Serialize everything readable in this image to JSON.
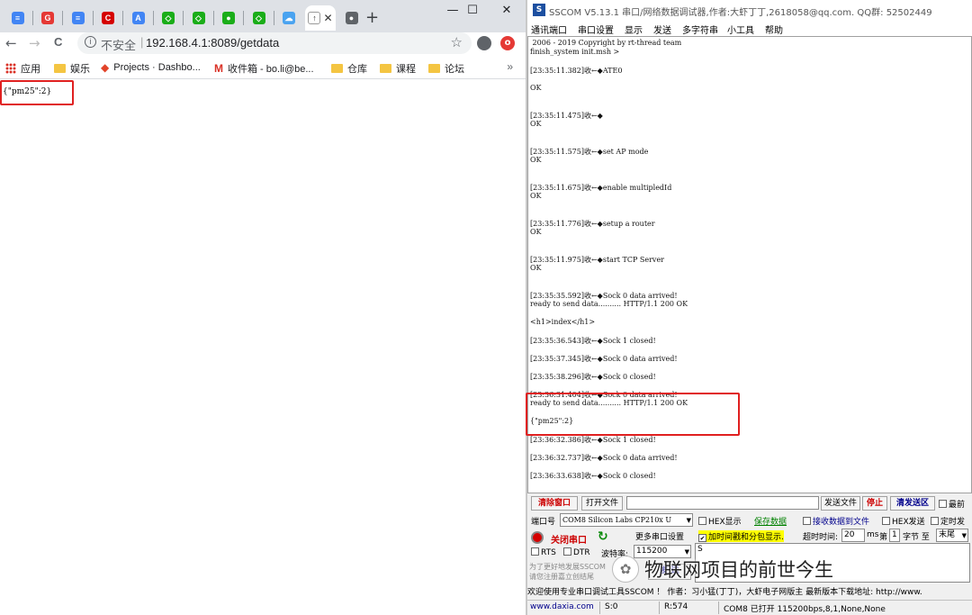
{
  "browser": {
    "tabs": [
      {
        "icon": "docs-icon",
        "color": "#4285f4",
        "glyph": "≡"
      },
      {
        "icon": "g-red-icon",
        "color": "#e53935",
        "glyph": "G"
      },
      {
        "icon": "docs-icon",
        "color": "#4285f4",
        "glyph": "≡"
      },
      {
        "icon": "c-red-icon",
        "color": "#d50000",
        "glyph": "C"
      },
      {
        "icon": "translate-icon",
        "color": "#4285f4",
        "glyph": "A"
      },
      {
        "icon": "recycle-green-icon",
        "color": "#1aad19",
        "glyph": "◇"
      },
      {
        "icon": "recycle-green-icon",
        "color": "#1aad19",
        "glyph": "◇"
      },
      {
        "icon": "wechat-icon",
        "color": "#1aad19",
        "glyph": "●"
      },
      {
        "icon": "recycle-green-icon",
        "color": "#1aad19",
        "glyph": "◇"
      },
      {
        "icon": "cloud-icon",
        "color": "#4aa3f0",
        "glyph": "☁"
      },
      {
        "icon": "page-icon",
        "color": "#ffffff",
        "glyph": "↑",
        "active": true
      },
      {
        "icon": "globe-icon",
        "color": "#5f6368",
        "glyph": "●"
      }
    ],
    "new_tab": "+",
    "window_controls": {
      "minimize": "—",
      "maximize": "☐",
      "close": "✕"
    },
    "nav": {
      "back": "←",
      "forward": "→",
      "reload": "C"
    },
    "omnibox": {
      "info": "i",
      "insecure": "不安全",
      "separator": "|",
      "url": "192.168.4.1:8089/getdata",
      "star": "☆"
    },
    "extension_badge": "o",
    "bookmarks": [
      {
        "label": "应用",
        "icon": "apps-grid-icon"
      },
      {
        "label": "娱乐",
        "icon": "folder-icon"
      },
      {
        "label": "Projects · Dashbo...",
        "icon": "gitlab-icon"
      },
      {
        "label": "收件箱 - bo.li@be...",
        "icon": "gmail-icon"
      },
      {
        "label": "仓库",
        "icon": "folder-icon"
      },
      {
        "label": "课程",
        "icon": "folder-icon"
      },
      {
        "label": "论坛",
        "icon": "folder-icon"
      }
    ],
    "bookmarks_more": "»",
    "page_text": "{\"pm25\":2}"
  },
  "sscom": {
    "title": "SSCOM V5.13.1 串口/网络数据调试器,作者:大虾丁丁,2618058@qq.com. QQ群: 52502449",
    "logo": "S",
    "menus": [
      "通讯端口",
      "串口设置",
      "显示",
      "发送",
      "多字符串",
      "小工具",
      "帮助"
    ],
    "terminal_lines": [
      " 2006 - 2019 Copyright by rt-thread team",
      "finish_system init.msh >",
      "[23:35:11.382]收←◆ATE0",
      "OK",
      "[23:35:11.475]收←◆",
      "OK",
      "[23:35:11.575]收←◆set AP mode",
      "OK",
      "[23:35:11.675]收←◆enable multipledId",
      "OK",
      "[23:35:11.776]收←◆setup a router",
      "OK",
      "[23:35:11.975]收←◆start TCP Server",
      "OK",
      "[23:35:35.592]收←◆Sock 0 data arrived!",
      "ready to send data.......... HTTP/1.1 200 OK",
      "<h1>index</h1>",
      "[23:35:36.543]收←◆Sock 1 closed!",
      "[23:35:37.345]收←◆Sock 0 data arrived!",
      "[23:35:38.296]收←◆Sock 0 closed!",
      "[23:36:31.404]收←◆Sock 0 data arrived!",
      "ready to send data.......... HTTP/1.1 200 OK",
      "{\"pm25\":2}",
      "[23:36:32.386]收←◆Sock 1 closed!",
      "[23:36:32.737]收←◆Sock 0 data arrived!",
      "[23:36:33.638]收←◆Sock 0 closed!"
    ],
    "panel": {
      "clear_window": "清除窗口",
      "open_file": "打开文件",
      "send_file": "发送文件",
      "stop": "停止",
      "clear_send": "清发送区",
      "last": "最前",
      "port_label": "端口号",
      "port_value": "COM8 Silicon Labs CP210x U",
      "hex_display": "HEX显示",
      "save_data": "保存数据",
      "receive_to_file": "接收数据到文件",
      "hex_send": "HEX发送",
      "timed_send": "定时发",
      "close_port": "关闭串口",
      "more_settings": "更多串口设置",
      "add_timestamp": "加时间戳和分包显示.",
      "timeout_label": "超时时间:",
      "timeout_value": "20",
      "ms": "ms",
      "nth_label": "第",
      "nth_value": "1",
      "byte_label": "字节 至",
      "end_value": "末尾",
      "rts": "RTS",
      "dtr": "DTR",
      "baud_label": "波特率:",
      "baud_value": "115200",
      "send_text": "S",
      "send_button": "发 送",
      "promo1": "为了更好地发展SSCOM",
      "promo2": "请您注册嘉立创结尾"
    },
    "ticker": "欢迎使用专业串口调试工具SSCOM ！  作者：习小猛(丁丁)，大虾电子网版主  最新版本下载地址: http://www.",
    "status": {
      "site": "www.daxia.com",
      "sent": "S:0",
      "received": "R:574",
      "port_status": "COM8 已打开  115200bps,8,1,None,None"
    }
  },
  "watermark": "物联网项目的前世今生",
  "watermark_icon": "wechat-icon"
}
